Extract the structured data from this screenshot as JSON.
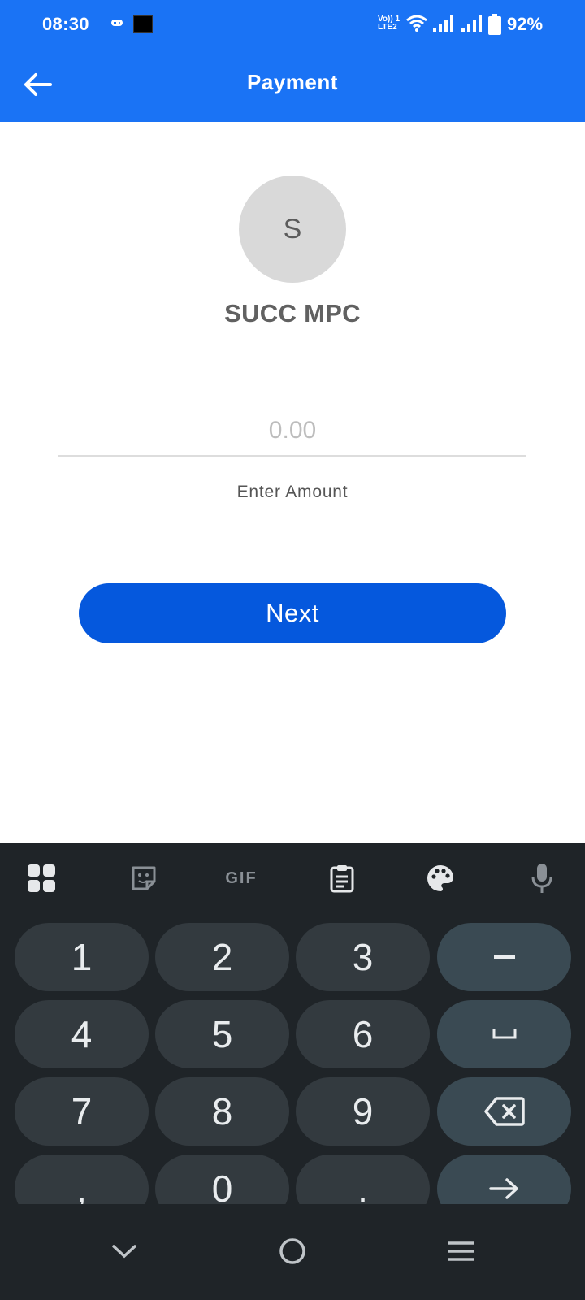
{
  "status_bar": {
    "time": "08:30",
    "volte_line1": "Vo)) 1",
    "volte_line2": "LTE2",
    "battery_percent": "92%",
    "icons": [
      "game-controller-icon",
      "notification-thumbnail-icon",
      "volte-icon",
      "wifi-icon",
      "signal-sim1-icon",
      "signal-sim2-icon",
      "battery-icon"
    ]
  },
  "app_bar": {
    "title": "Payment",
    "back_icon": "arrow-left-icon",
    "color": "#1A73F5"
  },
  "recipient": {
    "avatar_letter": "S",
    "name": "SUCC MPC"
  },
  "amount_field": {
    "value": "",
    "placeholder": "0.00",
    "label": "Enter Amount"
  },
  "next_button": {
    "label": "Next",
    "color": "#0558DD"
  },
  "keyboard": {
    "toolbar": [
      "apps-grid-icon",
      "sticker-icon",
      "gif-icon",
      "clipboard-icon",
      "palette-icon",
      "microphone-icon"
    ],
    "gif_label": "GIF",
    "rows": [
      [
        "1",
        "2",
        "3",
        "−"
      ],
      [
        "4",
        "5",
        "6",
        "␣"
      ],
      [
        "7",
        "8",
        "9",
        "backspace"
      ],
      [
        ",",
        "0",
        ".",
        "enter"
      ]
    ],
    "background": "#1F2428"
  },
  "nav_bar": {
    "buttons": [
      "chevron-down-icon",
      "home-circle-icon",
      "menu-icon"
    ]
  }
}
